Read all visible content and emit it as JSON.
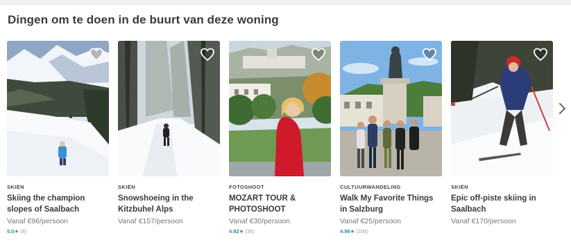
{
  "section": {
    "title": "Dingen om te doen in de buurt van deze woning"
  },
  "cards": [
    {
      "category": "SKIËN",
      "title": "Skiing the champion slopes of Saalbach",
      "price": "Vanaf €96/persoon",
      "rating": "5.0",
      "reviews": "(8)"
    },
    {
      "category": "SKIËN",
      "title": "Snowshoeing in the Kitzbuhel Alps",
      "price": "Vanaf €157/persoon",
      "rating": "",
      "reviews": ""
    },
    {
      "category": "FOTOSHOOT",
      "title": "MOZART TOUR & PHOTOSHOOT",
      "price": "Vanaf €30/persoon",
      "rating": "4.92",
      "reviews": "(36)"
    },
    {
      "category": "CULTUURWANDELING",
      "title": "Walk My Favorite Things in Salzburg",
      "price": "Vanaf €25/persoon",
      "rating": "4.98",
      "reviews": "(100)"
    },
    {
      "category": "SKIËN",
      "title": "Epic off-piste skiing in Saalbach",
      "price": "Vanaf €170/persoon",
      "rating": "",
      "reviews": ""
    }
  ],
  "icons": {
    "favorite": "heart-outline-icon",
    "next": "chevron-right-icon"
  },
  "colors": {
    "rating": "#2c8c96",
    "title": "#3a3a3a",
    "muted": "#777777"
  }
}
